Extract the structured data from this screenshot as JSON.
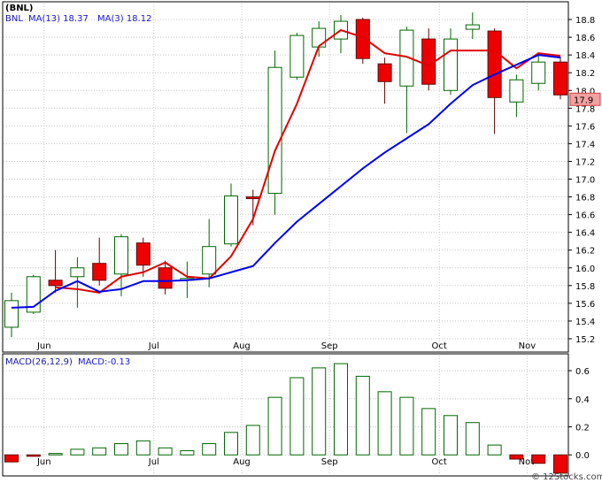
{
  "chart_data": [
    {
      "type": "candlestick",
      "symbol": "(BNL)",
      "legend": [
        {
          "symbol": "BNL",
          "value": "",
          "color": "#1a1aa0"
        },
        {
          "symbol": "MA(13)",
          "value": "18.37",
          "color": "#1a1acc"
        },
        {
          "symbol": "MA(3)",
          "value": "18.12",
          "color": "#1a1acc"
        }
      ],
      "last_price": "17.9",
      "ylim": [
        15.05,
        19.0
      ],
      "y_ticks": [
        15.2,
        15.4,
        15.6,
        15.8,
        16.0,
        16.2,
        16.4,
        16.6,
        16.8,
        17.0,
        17.2,
        17.4,
        17.6,
        17.8,
        18.0,
        18.2,
        18.4,
        18.6,
        18.8
      ],
      "x_labels": [
        {
          "label": "Jun",
          "index": 1
        },
        {
          "label": "Jul",
          "index": 6
        },
        {
          "label": "Aug",
          "index": 10
        },
        {
          "label": "Sep",
          "index": 14
        },
        {
          "label": "Oct",
          "index": 19
        },
        {
          "label": "Nov",
          "index": 23
        }
      ],
      "candles": [
        {
          "open": 15.33,
          "high": 15.72,
          "low": 15.22,
          "close": 15.63
        },
        {
          "open": 15.5,
          "high": 15.92,
          "low": 15.48,
          "close": 15.9
        },
        {
          "open": 15.86,
          "high": 16.2,
          "low": 15.72,
          "close": 15.8
        },
        {
          "open": 15.9,
          "high": 16.12,
          "low": 15.55,
          "close": 16.0
        },
        {
          "open": 16.05,
          "high": 16.34,
          "low": 15.8,
          "close": 15.86
        },
        {
          "open": 15.93,
          "high": 16.38,
          "low": 15.68,
          "close": 16.35
        },
        {
          "open": 16.28,
          "high": 16.34,
          "low": 15.9,
          "close": 16.03
        },
        {
          "open": 16.0,
          "high": 16.08,
          "low": 15.7,
          "close": 15.77
        },
        {
          "open": 15.88,
          "high": 16.07,
          "low": 15.66,
          "close": 15.88
        },
        {
          "open": 15.93,
          "high": 16.55,
          "low": 15.78,
          "close": 16.24
        },
        {
          "open": 16.27,
          "high": 16.95,
          "low": 16.24,
          "close": 16.81
        },
        {
          "open": 16.8,
          "high": 16.88,
          "low": 16.48,
          "close": 16.78
        },
        {
          "open": 16.84,
          "high": 18.45,
          "low": 16.6,
          "close": 18.26
        },
        {
          "open": 18.15,
          "high": 18.65,
          "low": 18.12,
          "close": 18.62
        },
        {
          "open": 18.49,
          "high": 18.78,
          "low": 18.38,
          "close": 18.7
        },
        {
          "open": 18.58,
          "high": 18.85,
          "low": 18.42,
          "close": 18.78
        },
        {
          "open": 18.8,
          "high": 18.82,
          "low": 18.3,
          "close": 18.36
        },
        {
          "open": 18.3,
          "high": 18.37,
          "low": 17.85,
          "close": 18.1
        },
        {
          "open": 18.05,
          "high": 18.72,
          "low": 17.52,
          "close": 18.68
        },
        {
          "open": 18.58,
          "high": 18.7,
          "low": 18.0,
          "close": 18.07
        },
        {
          "open": 18.0,
          "high": 18.7,
          "low": 17.95,
          "close": 18.58
        },
        {
          "open": 18.69,
          "high": 18.88,
          "low": 18.58,
          "close": 18.74
        },
        {
          "open": 18.67,
          "high": 18.7,
          "low": 17.51,
          "close": 17.92
        },
        {
          "open": 17.87,
          "high": 18.18,
          "low": 17.7,
          "close": 18.12
        },
        {
          "open": 18.08,
          "high": 18.4,
          "low": 18.0,
          "close": 18.32
        },
        {
          "open": 18.32,
          "high": 18.38,
          "low": 17.9,
          "close": 17.95
        }
      ],
      "ma3": [
        null,
        null,
        15.78,
        15.76,
        15.72,
        15.9,
        15.95,
        16.06,
        15.9,
        15.88,
        16.13,
        16.55,
        17.32,
        17.85,
        18.5,
        18.68,
        18.6,
        18.42,
        18.38,
        18.28,
        18.45,
        18.45,
        18.45,
        18.25,
        18.42,
        18.39
      ],
      "ma13": [
        15.55,
        15.56,
        15.74,
        15.85,
        15.73,
        15.76,
        15.85,
        15.85,
        15.86,
        15.88,
        15.95,
        16.02,
        16.28,
        16.52,
        16.72,
        16.92,
        17.12,
        17.3,
        17.46,
        17.62,
        17.85,
        18.06,
        18.18,
        18.29,
        18.4,
        18.37
      ],
      "ma3_visible_from": 0,
      "ma13_visible_from": 0
    },
    {
      "type": "bar",
      "legend": [
        {
          "label": "MACD(26,12,9)",
          "color": "#1a1aa0"
        },
        {
          "label": "MACD:-0.13",
          "color": "#1a1acc"
        }
      ],
      "ylim": [
        -0.15,
        0.72
      ],
      "y_ticks": [
        0.0,
        0.2,
        0.4,
        0.6
      ],
      "y_tick_labels": [
        "0.0",
        "0.2",
        "0.4",
        "0.6"
      ],
      "x_labels": [
        {
          "label": "Jun",
          "index": 1
        },
        {
          "label": "Jul",
          "index": 6
        },
        {
          "label": "Aug",
          "index": 10
        },
        {
          "label": "Sep",
          "index": 14
        },
        {
          "label": "Oct",
          "index": 19
        },
        {
          "label": "Nov",
          "index": 23
        }
      ],
      "values": [
        -0.05,
        -0.01,
        0.01,
        0.04,
        0.05,
        0.08,
        0.1,
        0.05,
        0.03,
        0.08,
        0.16,
        0.21,
        0.41,
        0.55,
        0.62,
        0.65,
        0.56,
        0.45,
        0.41,
        0.33,
        0.28,
        0.23,
        0.07,
        -0.03,
        -0.06,
        -0.13
      ]
    }
  ]
}
